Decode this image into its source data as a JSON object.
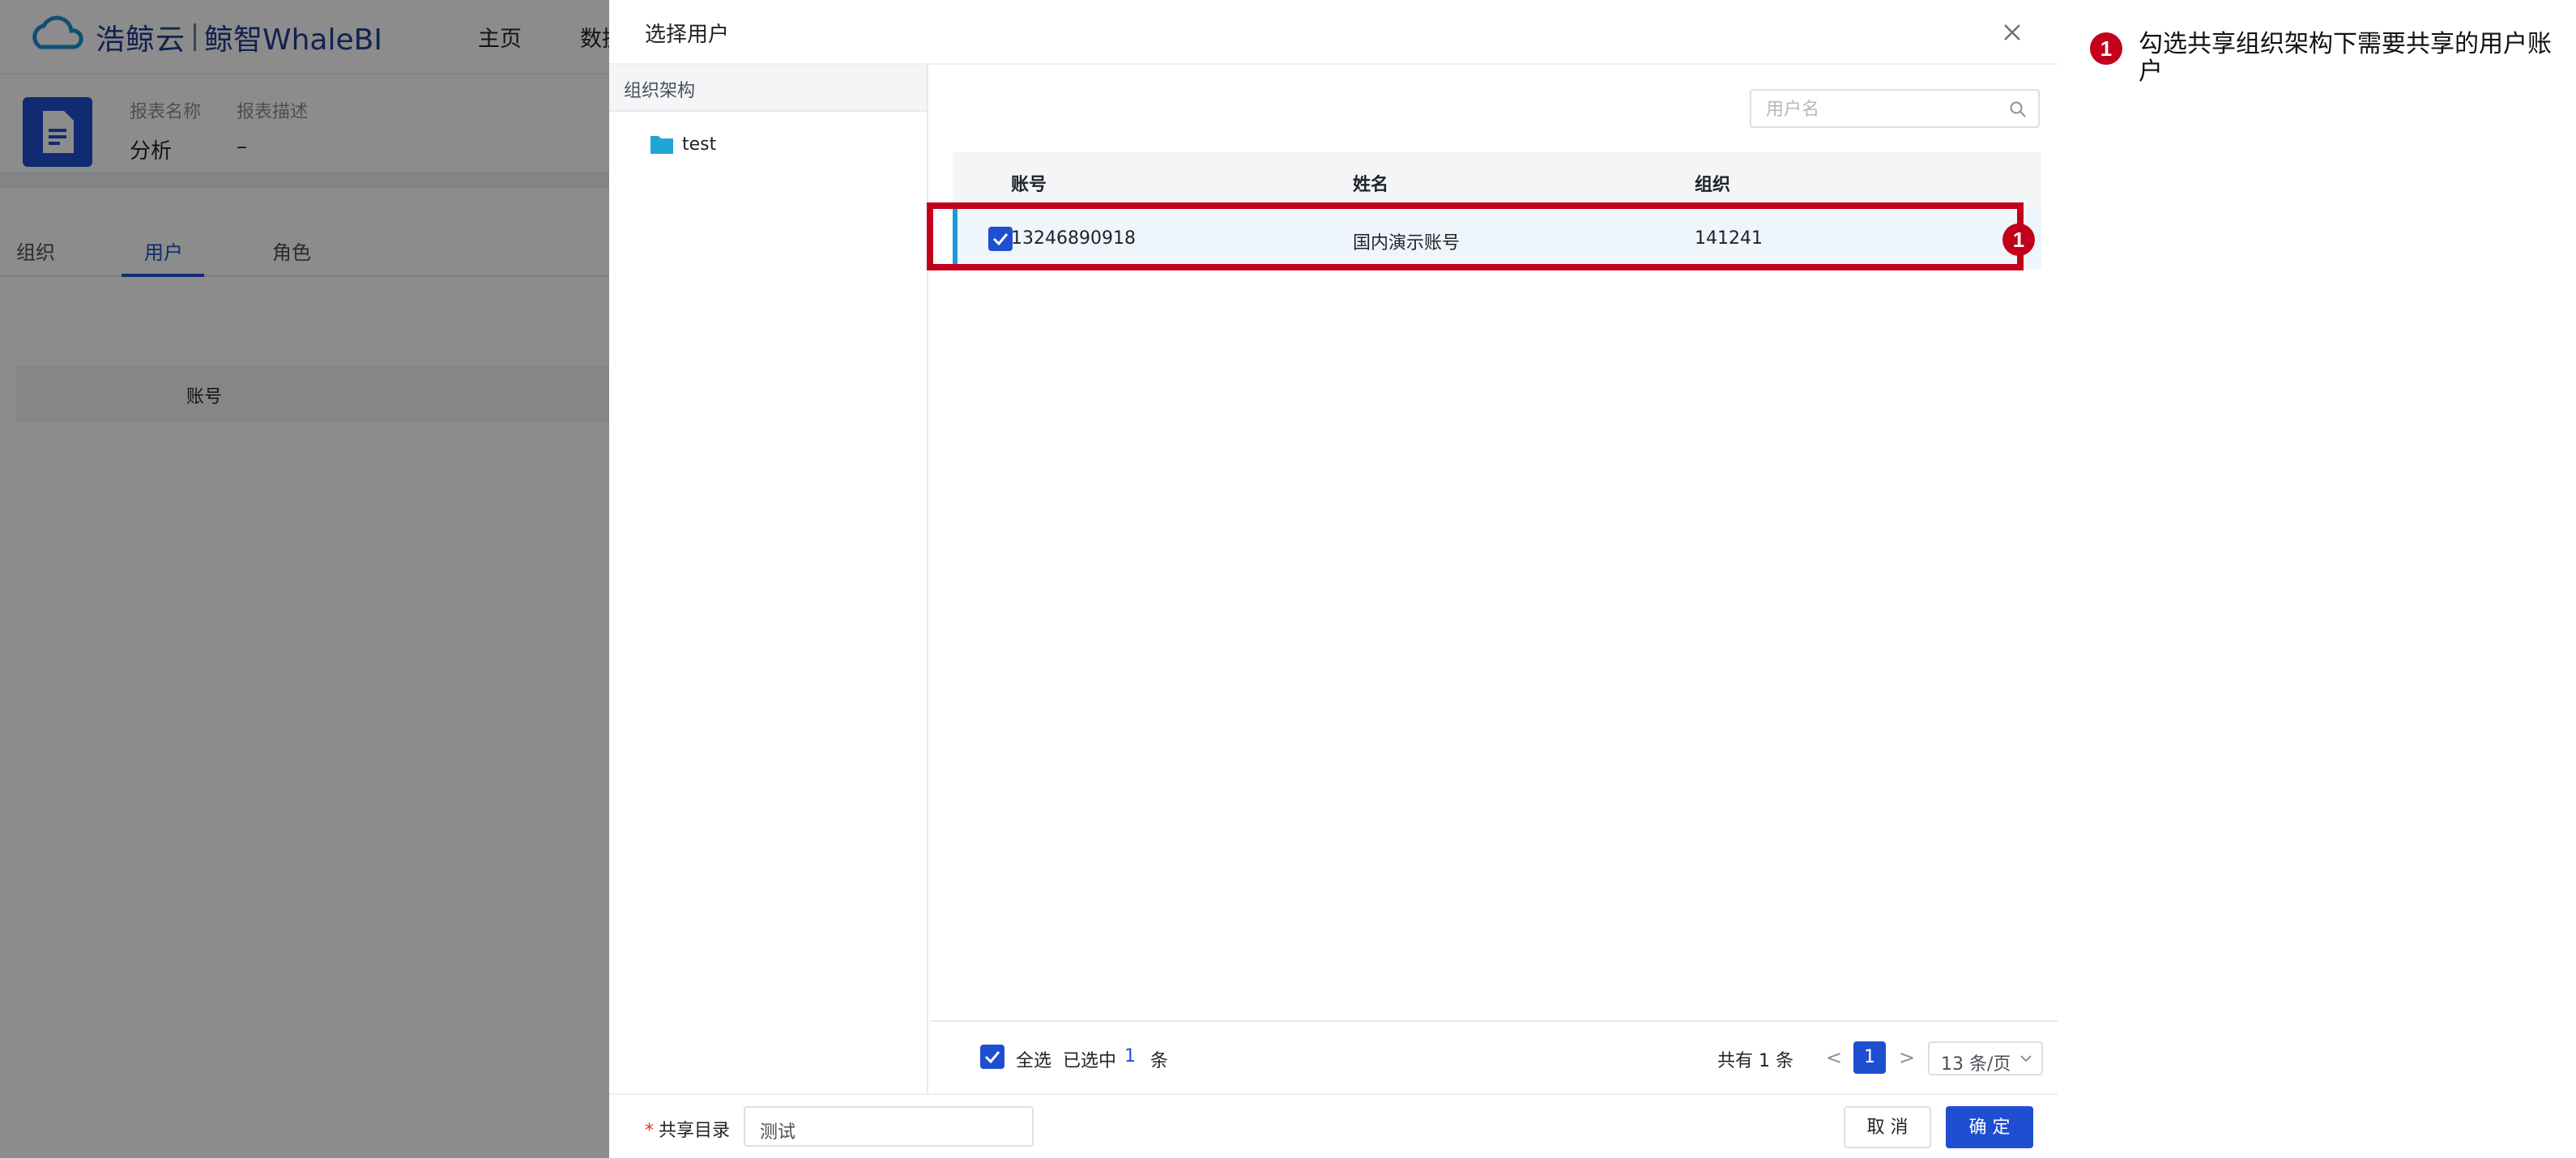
{
  "app": {
    "logo_text": "浩鲸云",
    "logo_sub": "鲸智WhaleBI",
    "nav": [
      "主页",
      "数据"
    ]
  },
  "report": {
    "name_label": "报表名称",
    "desc_label": "报表描述",
    "name_value": "分析",
    "desc_value": "–"
  },
  "bg_tabs": [
    "组织",
    "用户",
    "角色"
  ],
  "bg_table": {
    "col_account": "账号"
  },
  "drawer": {
    "title": "选择用户",
    "org_title": "组织架构",
    "org_nodes": [
      "test"
    ],
    "search_placeholder": "用户名",
    "columns": [
      "账号",
      "姓名",
      "组织"
    ],
    "rows": [
      {
        "account": "13246890918",
        "name": "国内演示账号",
        "org": "141241",
        "checked": true
      }
    ],
    "footer": {
      "select_all": "全选",
      "selected_prefix": "已选中",
      "selected_count": "1",
      "selected_suffix": "条",
      "total": "共有 1 条",
      "prev": "<",
      "page": "1",
      "next": ">",
      "page_size": "13 条/页"
    },
    "share_dir_label": "共享目录",
    "share_dir_value": "测试",
    "cancel": "取 消",
    "ok": "确 定"
  },
  "annotation": {
    "marker": "1",
    "text": "勾选共享组织架构下需要共享的用户账户"
  },
  "colors": {
    "primary": "#1f4fd1",
    "highlight": "#c3001b",
    "row_bg": "#eef5fb",
    "folder": "#1fa6d6"
  }
}
